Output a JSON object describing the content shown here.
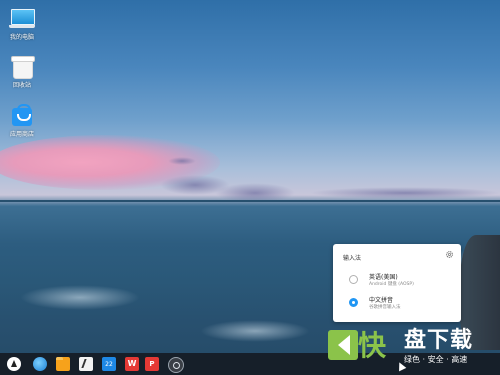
{
  "desktop": {
    "icons": [
      {
        "label": "我的电脑",
        "icon": "computer-icon"
      },
      {
        "label": "回收站",
        "icon": "recycle-bin-icon"
      },
      {
        "label": "应用商店",
        "icon": "app-store-icon"
      }
    ]
  },
  "input_method_panel": {
    "title": "输入法",
    "settings_icon": "gear-icon",
    "options": [
      {
        "name": "英语(美国)",
        "subtitle": "Android 键盘 (AOSP)",
        "selected": false
      },
      {
        "name": "中文拼音",
        "subtitle": "谷歌拼音输入法",
        "selected": true
      }
    ],
    "accent_color": "#2196f3"
  },
  "taskbar": {
    "apps": [
      {
        "icon": "launcher-icon"
      },
      {
        "icon": "browser-icon"
      },
      {
        "icon": "file-manager-icon"
      },
      {
        "icon": "editor-icon"
      },
      {
        "icon": "calendar-icon",
        "text": "22"
      },
      {
        "icon": "wps-icon",
        "text": "W"
      },
      {
        "icon": "wps-presentation-icon",
        "text": "P"
      },
      {
        "icon": "settings-icon"
      }
    ]
  },
  "watermark": {
    "logo_char": "快",
    "name": "盘下载",
    "tagline": "绿色 · 安全 · 高速",
    "color": "#8bc34a"
  }
}
